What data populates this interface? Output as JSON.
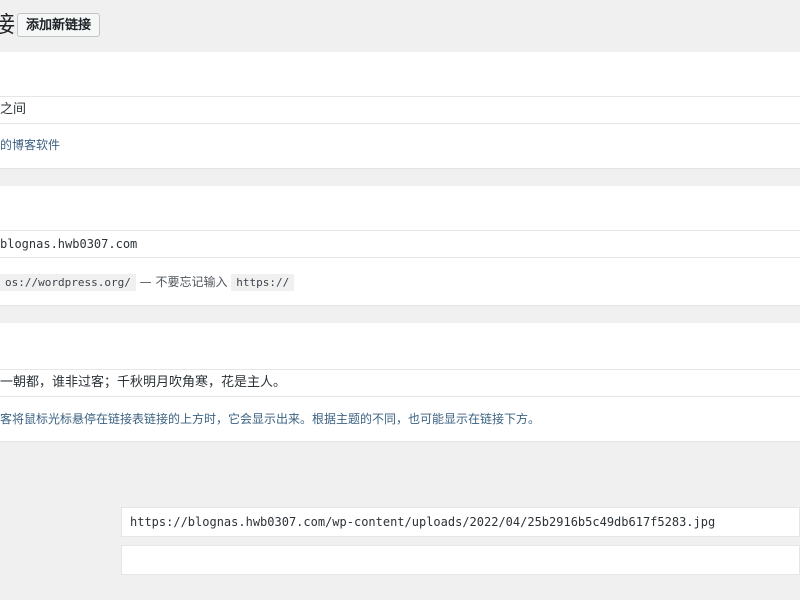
{
  "header": {
    "title_partial": "接",
    "add_button_label": "添加新链接"
  },
  "name_section": {
    "value_partial": "之间",
    "description_partial": "的博客软件"
  },
  "url_section": {
    "value_partial": "blognas.hwb0307.com",
    "desc_code1": "os://wordpress.org/",
    "desc_mid": " — 不要忘记输入 ",
    "desc_code2": "https://"
  },
  "desc_section": {
    "value_partial": "一朝都，谁非过客；千秋明月吹角寒，花是主人。",
    "description_partial": "客将鼠标光标悬停在链接表链接的上方时，它会显示出来。根据主题的不同，也可能显示在链接下方。"
  },
  "image_section": {
    "image_url": "https://blognas.hwb0307.com/wp-content/uploads/2022/04/25b2916b5c49db617f5283.jpg",
    "second_value": ""
  }
}
